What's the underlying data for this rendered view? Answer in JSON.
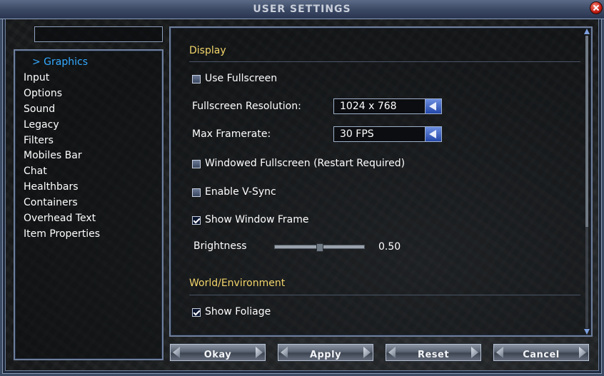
{
  "window": {
    "title": "USER SETTINGS"
  },
  "search": {
    "placeholder": ""
  },
  "sidebar": {
    "items": [
      {
        "label": "> Graphics",
        "active": true
      },
      {
        "label": "Input"
      },
      {
        "label": "Options"
      },
      {
        "label": "Sound"
      },
      {
        "label": "Legacy"
      },
      {
        "label": "Filters"
      },
      {
        "label": "Mobiles Bar"
      },
      {
        "label": "Chat"
      },
      {
        "label": "Healthbars"
      },
      {
        "label": "Containers"
      },
      {
        "label": "Overhead Text"
      },
      {
        "label": "Item Properties"
      }
    ]
  },
  "content": {
    "display": {
      "title": "Display",
      "use_fullscreen": {
        "label": "Use Fullscreen",
        "checked": false
      },
      "fullscreen_resolution": {
        "label": "Fullscreen Resolution:",
        "value": "1024 x 768"
      },
      "max_framerate": {
        "label": "Max Framerate:",
        "value": "30 FPS"
      },
      "windowed_fullscreen": {
        "label": "Windowed Fullscreen (Restart Required)",
        "checked": false
      },
      "enable_vsync": {
        "label": "Enable V-Sync",
        "checked": false
      },
      "show_window_frame": {
        "label": "Show Window Frame",
        "checked": true
      },
      "brightness": {
        "label": "Brightness",
        "value": "0.50",
        "level": 0.5
      }
    },
    "world": {
      "title": "World/Environment",
      "show_foliage": {
        "label": "Show Foliage",
        "checked": true
      }
    },
    "scrollbar": {
      "position": 0
    }
  },
  "buttons": {
    "okay": "Okay",
    "apply": "Apply",
    "reset": "Reset",
    "cancel": "Cancel"
  },
  "colors": {
    "accent_blue": "#33a9ff",
    "section_gold": "#f2d56a",
    "frame_blue": "#3c4a66"
  }
}
